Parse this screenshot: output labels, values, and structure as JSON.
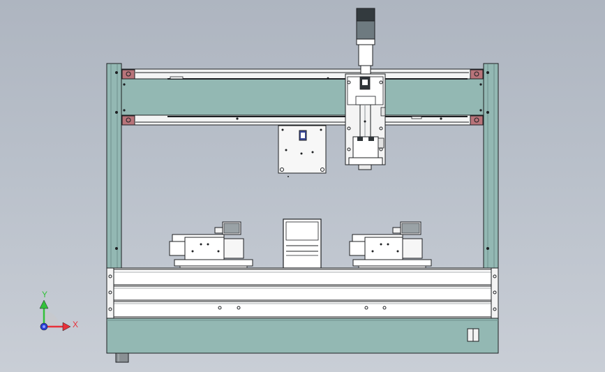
{
  "triad": {
    "x_label": "X",
    "y_label": "Y",
    "x_color": "#e8313a",
    "y_color": "#32c13a",
    "z_color": "#2a3fd6"
  },
  "colors": {
    "background_top": "#aeb5c0",
    "background_bottom": "#c9ced6",
    "frame_teal": "#93b8b3",
    "frame_teal_dark": "#6f918c",
    "rail_white": "#f3f4f4",
    "bracket_brown": "#b8747a",
    "outline": "#1d1f22"
  }
}
